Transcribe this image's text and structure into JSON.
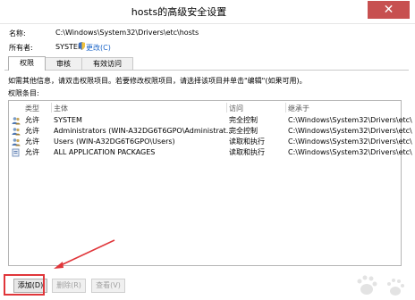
{
  "window": {
    "title": "hosts的高级安全设置",
    "close_glyph": "✕",
    "accent_close": "#c75050"
  },
  "object": {
    "name_label": "名称:",
    "name_value": "C:\\Windows\\System32\\Drivers\\etc\\hosts"
  },
  "owner": {
    "label": "所有者:",
    "value": "SYSTEM",
    "change_link": "更改(C)"
  },
  "tabs": [
    {
      "label": "权限",
      "active": true
    },
    {
      "label": "审核",
      "active": false
    },
    {
      "label": "有效访问",
      "active": false
    }
  ],
  "info_text": "如需其他信息，请双击权限项目。若要修改权限项目，请选择该项目并单击\"编辑\"(如果可用)。",
  "entries_label": "权限条目:",
  "table": {
    "headers": {
      "type": "类型",
      "principal": "主体",
      "access": "访问",
      "inherited": "继承于"
    },
    "rows": [
      {
        "icon": "user-group-icon",
        "type": "允许",
        "principal": "SYSTEM",
        "access": "完全控制",
        "inherited": "C:\\Windows\\System32\\Drivers\\etc\\"
      },
      {
        "icon": "user-group-icon",
        "type": "允许",
        "principal": "Administrators (WIN-A32DG6T6GPO\\Administrat...",
        "access": "完全控制",
        "inherited": "C:\\Windows\\System32\\Drivers\\etc\\"
      },
      {
        "icon": "user-group-icon",
        "type": "允许",
        "principal": "Users (WIN-A32DG6T6GPO\\Users)",
        "access": "读取和执行",
        "inherited": "C:\\Windows\\System32\\Drivers\\etc\\"
      },
      {
        "icon": "package-icon",
        "type": "允许",
        "principal": "ALL APPLICATION PACKAGES",
        "access": "读取和执行",
        "inherited": "C:\\Windows\\System32\\Drivers\\etc\\"
      }
    ]
  },
  "buttons": {
    "add": {
      "label": "添加(D)",
      "enabled": true
    },
    "delete": {
      "label": "删除(R)",
      "enabled": false
    },
    "view": {
      "label": "查看(V)",
      "enabled": false
    }
  },
  "annotation": {
    "color": "#e0363a"
  }
}
